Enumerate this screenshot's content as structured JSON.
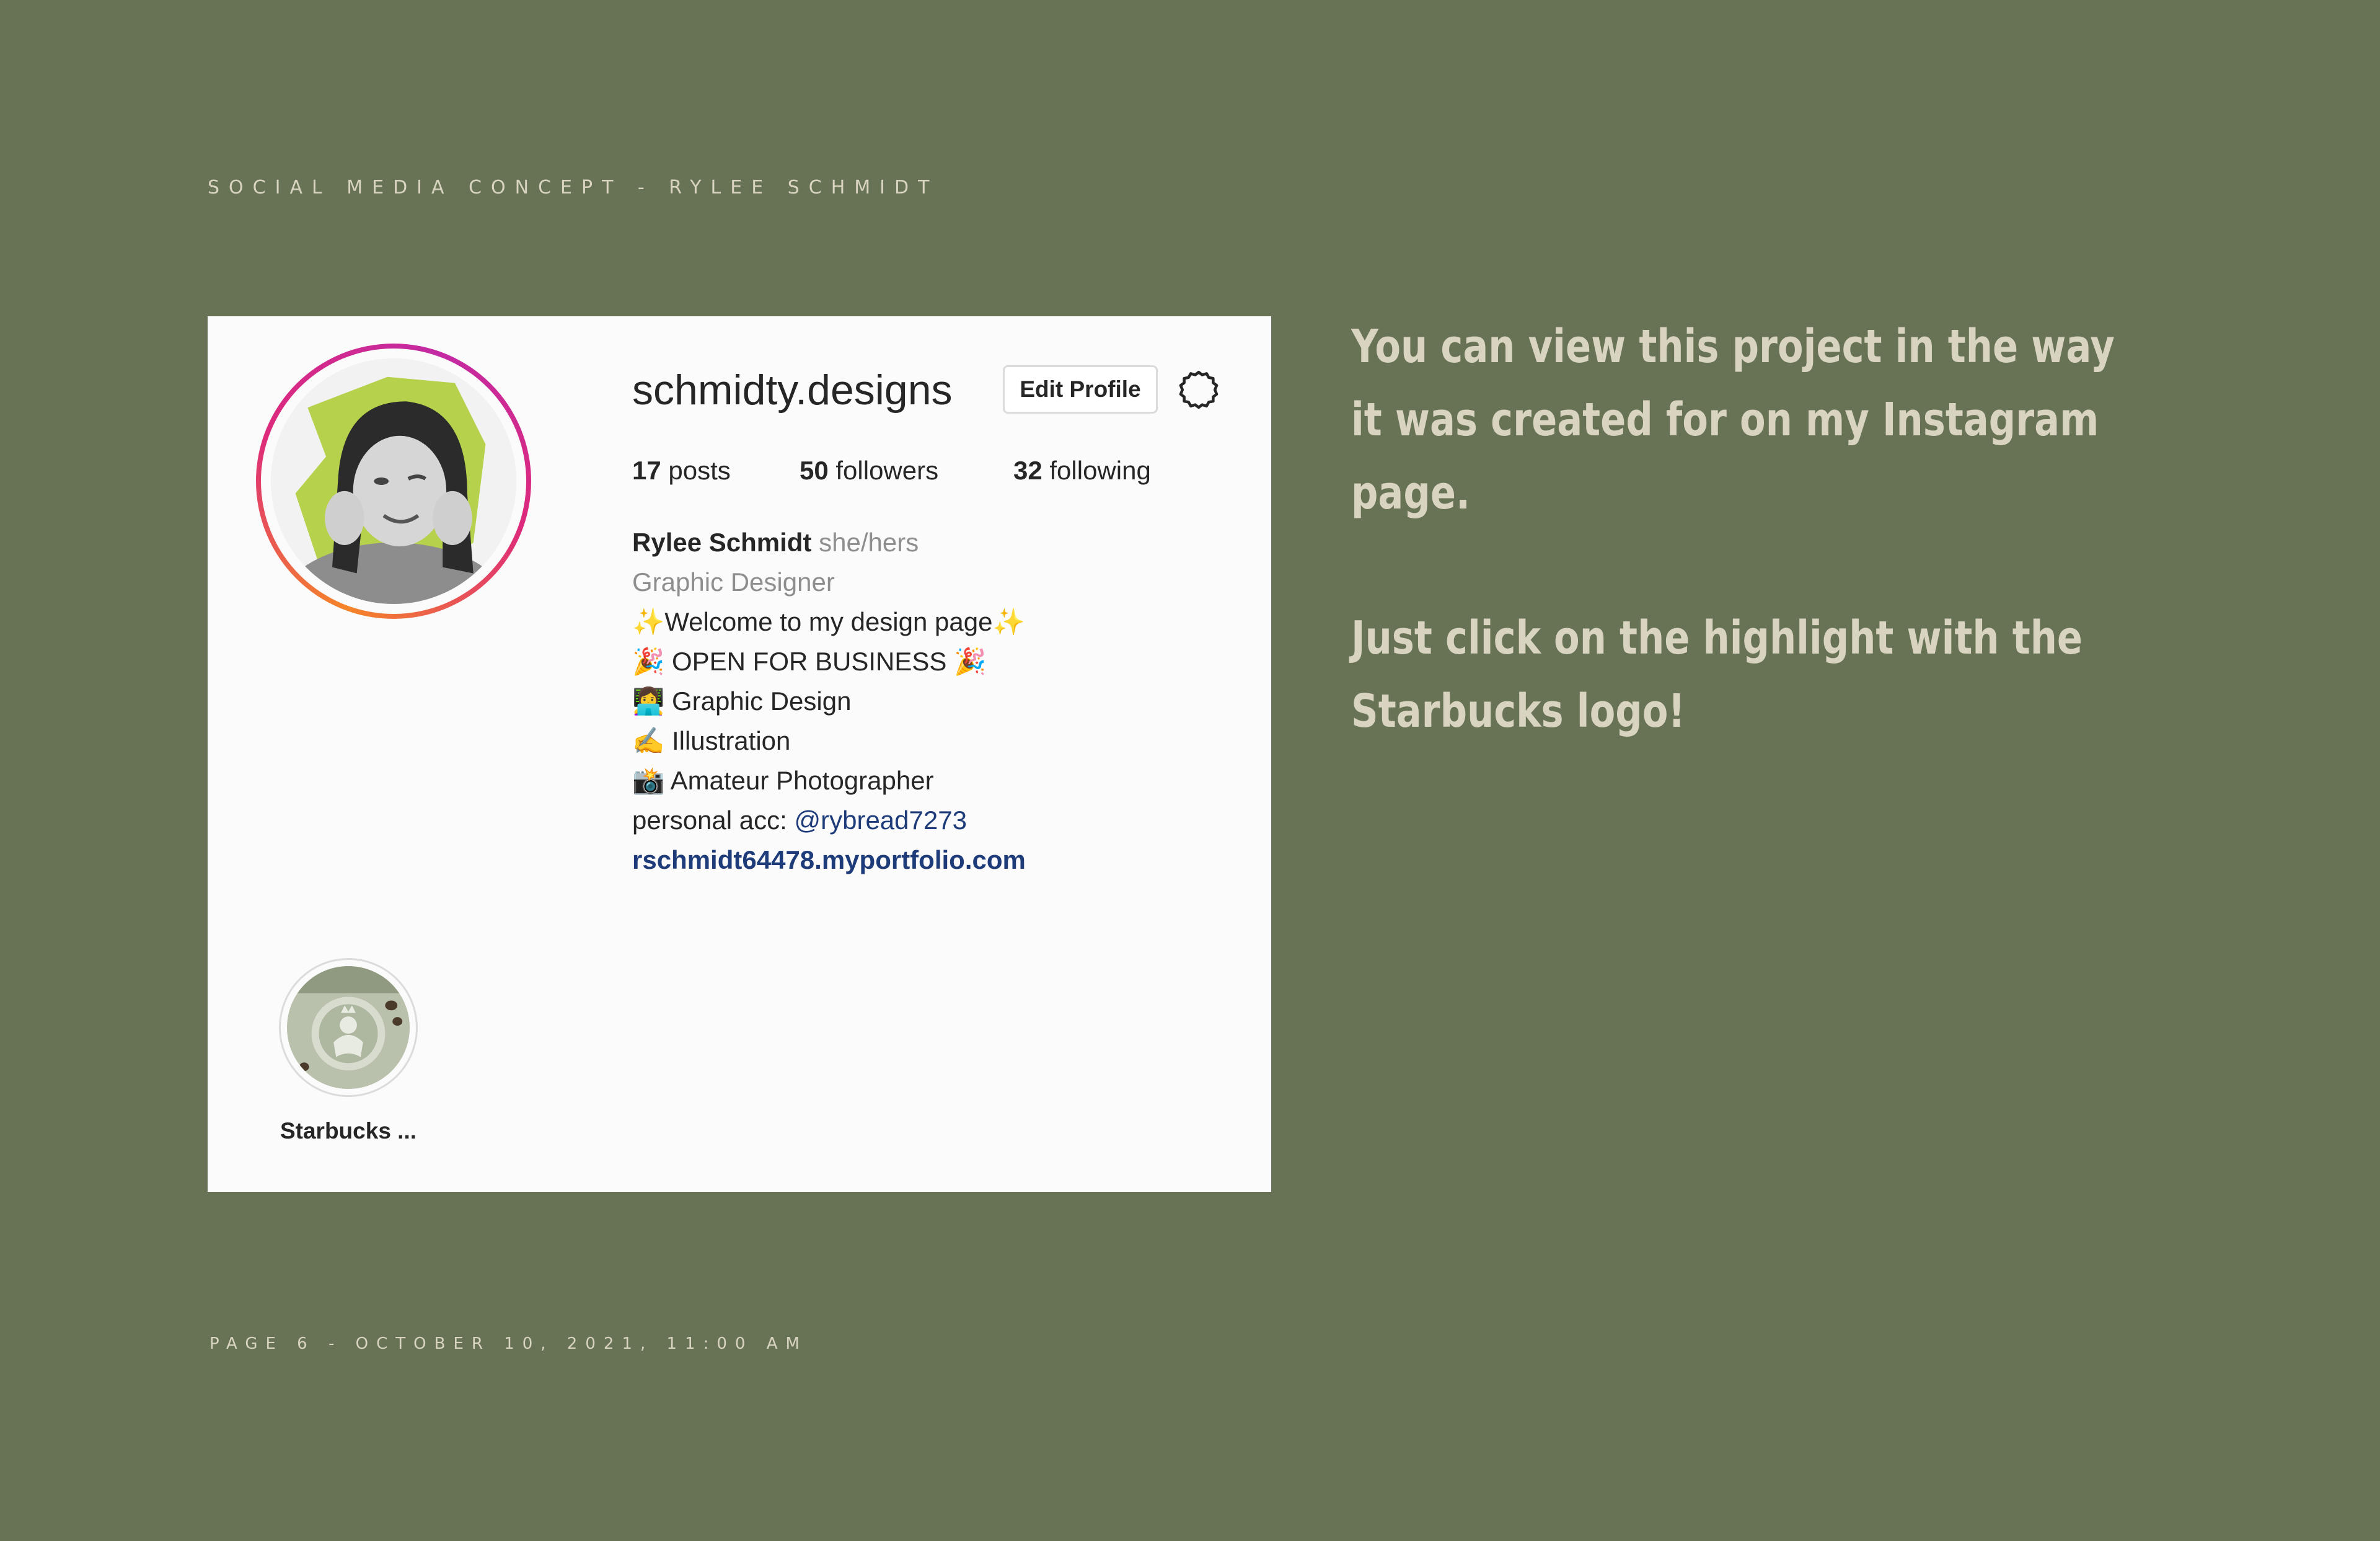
{
  "header": {
    "caption": "SOCIAL MEDIA CONCEPT - RYLEE SCHMIDT"
  },
  "profile": {
    "username": "schmidty.designs",
    "edit_profile_label": "Edit Profile",
    "stats": {
      "posts_count": "17",
      "posts_label": " posts",
      "followers_count": "50",
      "followers_label": " followers",
      "following_count": "32",
      "following_label": " following"
    },
    "bio": {
      "name": "Rylee Schmidt",
      "pronouns": "she/hers",
      "category": "Graphic Designer",
      "line_welcome": "✨Welcome to my design page✨",
      "line_open": "🎉 OPEN FOR BUSINESS 🎉",
      "line_graphic": "👩‍💻 Graphic Design",
      "line_illustration": "✍️ Illustration",
      "line_photographer": "📸 Amateur Photographer",
      "personal_prefix": "personal acc: ",
      "personal_handle": "@rybread7273",
      "website": "rschmidt64478.myportfolio.com"
    },
    "highlight": {
      "label": "Starbucks ..."
    },
    "icons": {
      "settings": "settings-gear-icon",
      "highlight_image": "starbucks-logo-icon"
    }
  },
  "side_text": {
    "paragraph_1": "You can view this project in the way it was created for on my Instagram page.",
    "paragraph_2": "Just click on the highlight with the Starbucks logo!"
  },
  "footer": {
    "caption": "PAGE 6 - OCTOBER 10, 2021, 11:00 AM"
  },
  "colors": {
    "background": "#687255",
    "caption_text": "#d8d4c0",
    "card_background": "#fafbfa",
    "link_blue": "#1f3c7a",
    "avatar_ring_start": "#f58529",
    "avatar_ring_end": "#c32aa3"
  }
}
